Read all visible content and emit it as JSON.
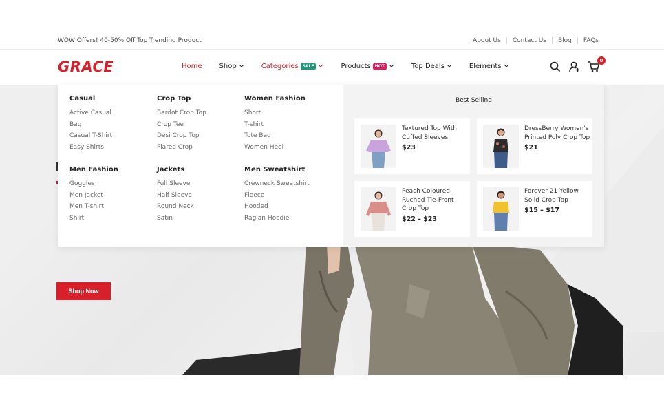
{
  "topbar": {
    "offer": "WOW Offers! 40-50% Off Top Trending Product",
    "links": [
      "About Us",
      "Contact Us",
      "Blog",
      "FAQs"
    ]
  },
  "header": {
    "logo": "GRACE",
    "nav": {
      "home": "Home",
      "shop": "Shop",
      "categories": "Categories",
      "categories_badge": "SALE",
      "products": "Products",
      "products_badge": "HOT",
      "top_deals": "Top Deals",
      "elements": "Elements"
    },
    "cart_count": "0"
  },
  "colors": {
    "accent": "#d7202a",
    "sale": "#159b7a",
    "hot": "#e8165f"
  },
  "mega_menu": {
    "groups": [
      {
        "title": "Casual",
        "items": [
          "Active Casual",
          "Bag",
          "Casual T-Shirt",
          "Easy Shirts"
        ]
      },
      {
        "title": "Crop Top",
        "items": [
          "Bardot Crop Top",
          "Crop Tee",
          "Desi Crop Top",
          "Flared Crop"
        ]
      },
      {
        "title": "Women Fashion",
        "items": [
          "Short",
          "T-shirt",
          "Tote Bag",
          "Women Heel"
        ]
      },
      {
        "title": "Men Fashion",
        "items": [
          "Goggles",
          "Men Jacket",
          "Men T-shirt",
          "Shirt"
        ]
      },
      {
        "title": "Jackets",
        "items": [
          "Full Sleeve",
          "Half Sleeve",
          "Round Neck",
          "Satin"
        ]
      },
      {
        "title": "Men Sweatshirt",
        "items": [
          "Crewneck Sweatshirt",
          "Fleece",
          "Hooded",
          "Raglan Hoodie"
        ]
      }
    ],
    "best_selling": {
      "title": "Best Selling",
      "products": [
        {
          "name": "Textured Top With Cuffed Sleeves",
          "price": "$23"
        },
        {
          "name": "DressBerry Women's Printed Poly Crop Top",
          "price": "$21"
        },
        {
          "name": "Peach Coloured Ruched Tie-Front Crop Top",
          "price": "$22 – $23"
        },
        {
          "name": "Forever 21 Yellow Solid Crop Top",
          "price": "$15 – $17"
        }
      ]
    }
  },
  "hero": {
    "cta": "Shop Now"
  }
}
